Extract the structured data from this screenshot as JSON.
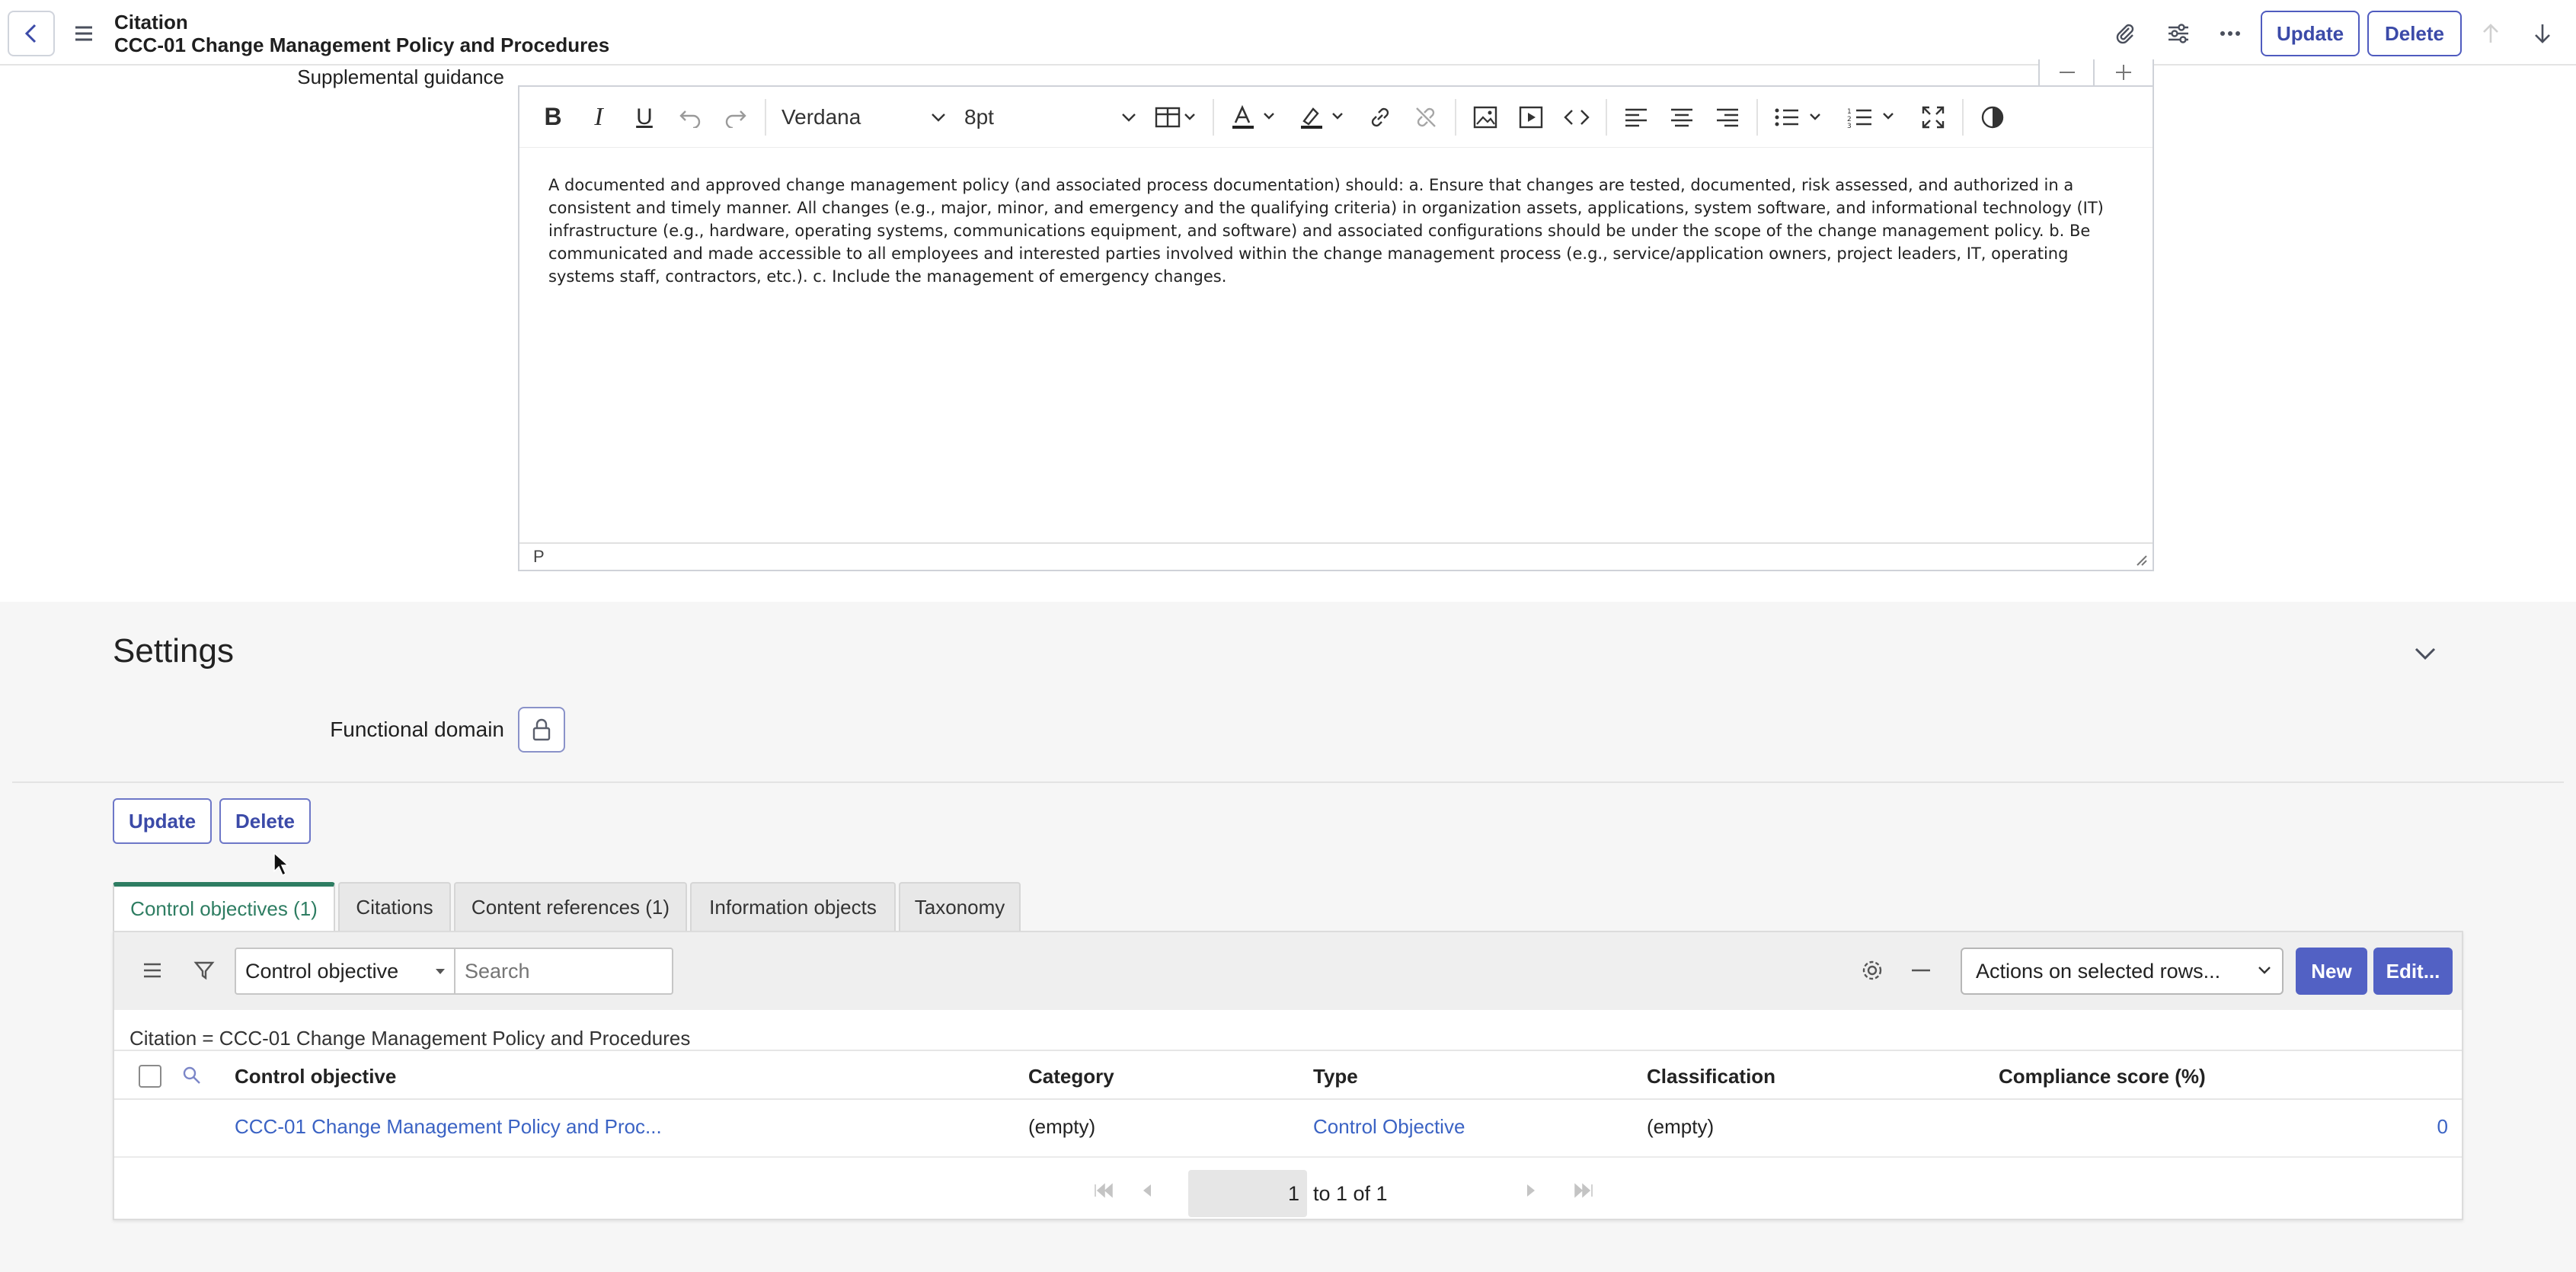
{
  "header": {
    "record_type": "Citation",
    "record_name": "CCC-01 Change Management Policy and Procedures",
    "update_label": "Update",
    "delete_label": "Delete"
  },
  "supplemental_guidance": {
    "label": "Supplemental guidance",
    "font_name": "Verdana",
    "font_size": "8pt",
    "content": "A documented and approved change management policy (and associated process documentation) should: a. Ensure that changes are tested, documented, risk assessed, and authorized in a consistent and timely manner. All changes (e.g., major, minor, and emergency and the qualifying criteria) in organization assets, applications, system software, and informational technology (IT) infrastructure (e.g., hardware, operating systems, communications equipment, and software) and associated configurations should be under the scope of the change management policy. b. Be communicated and made accessible to all employees and interested parties involved within the change management process (e.g., service/application owners, project leaders, IT, operating systems staff, contractors, etc.). c. Include the management of emergency changes.",
    "status_path": "P"
  },
  "settings": {
    "title": "Settings",
    "functional_domain_label": "Functional domain"
  },
  "form_actions": {
    "update_label": "Update",
    "delete_label": "Delete"
  },
  "tabs": [
    {
      "label": "Control objectives (1)",
      "active": true
    },
    {
      "label": "Citations",
      "active": false
    },
    {
      "label": "Content references (1)",
      "active": false
    },
    {
      "label": "Information objects",
      "active": false
    },
    {
      "label": "Taxonomy",
      "active": false
    }
  ],
  "related_list": {
    "search_field": "Control objective",
    "search_placeholder": "Search",
    "actions_select": "Actions on selected rows...",
    "new_label": "New",
    "edit_label": "Edit...",
    "breadcrumb": "Citation = CCC-01 Change Management Policy and Procedures",
    "columns": [
      "Control objective",
      "Category",
      "Type",
      "Classification",
      "Compliance score (%)"
    ],
    "rows": [
      {
        "control_objective": "CCC-01 Change Management Policy and Proc...",
        "category": "(empty)",
        "type": "Control Objective",
        "classification": "(empty)",
        "compliance_score": "0"
      }
    ],
    "pagination": {
      "current": "1",
      "summary": "to 1 of 1"
    }
  },
  "colors": {
    "accent": "#5261c4",
    "tab_active": "#2e7d62",
    "link": "#3b63c4"
  }
}
